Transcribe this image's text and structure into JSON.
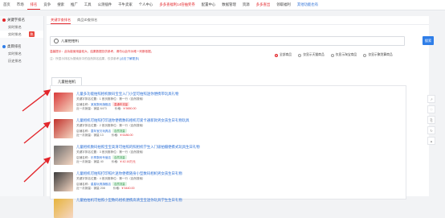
{
  "topnav": {
    "items": [
      {
        "label": "首页",
        "style": "normal"
      },
      {
        "label": "市场",
        "style": "normal"
      },
      {
        "label": "排名",
        "style": "active"
      },
      {
        "label": "竞争",
        "style": "normal"
      },
      {
        "label": "搜索",
        "style": "normal"
      },
      {
        "label": "推广",
        "style": "normal"
      },
      {
        "label": "工具",
        "style": "normal"
      },
      {
        "label": "公测插件",
        "style": "normal"
      },
      {
        "label": "千牛卖家",
        "style": "normal"
      },
      {
        "label": "个人中心",
        "style": "normal"
      },
      {
        "label": "多多查福利14倍抽奖券",
        "style": "red"
      },
      {
        "label": "配置中心",
        "style": "normal"
      },
      {
        "label": "数据管理",
        "style": "normal"
      },
      {
        "label": "资源",
        "style": "normal"
      },
      {
        "label": "多多查出",
        "style": "red"
      },
      {
        "label": "领取福利",
        "style": "normal"
      },
      {
        "label": "其他功能也有",
        "style": "blue"
      }
    ]
  },
  "sidebar": {
    "groups": [
      {
        "label": "关键字排名",
        "color": "#e3262b",
        "items": [
          {
            "label": "实时排名",
            "badge": ""
          },
          {
            "label": "实时排名",
            "badge": "热",
            "active": true
          }
        ]
      },
      {
        "label": "类目排名",
        "color": "#2f7ee8",
        "items": [
          {
            "label": "实时排名",
            "badge": ""
          },
          {
            "label": "历史排名",
            "badge": ""
          }
        ]
      }
    ]
  },
  "main": {
    "tabs": [
      {
        "label": "关键字查排名"
      },
      {
        "label": "商品ID查排名"
      }
    ],
    "search": {
      "value": "儿童拍拍机",
      "button": "搜索"
    },
    "hint": "温馨提示：此功能使用量较大，结果数据仅供参考，请勿以此作为唯一判断依据。",
    "hint2": "注：所显示排名为搜索页中的自然排名结果，仅供参考",
    "hint2_link": "[点击了解更多]",
    "radios": [
      {
        "label": "全部商品",
        "on": true
      },
      {
        "label": "仅显示天猫商品",
        "on": false
      },
      {
        "label": "仅显示淘宝商品",
        "on": false
      },
      {
        "label": "仅显示聚划算商品",
        "on": false
      }
    ],
    "result_tab": "儿童拍拍机"
  },
  "results": [
    {
      "title": "儿童多功能拍照相机数码宝宝入门小型可拍照迷你便携带玩具礼物",
      "row1": "关键字排名位置：1  首页推荐位：第一行（自然搜索）",
      "row2": "店铺名称：",
      "shop": "某某数码旗舰店",
      "tag": "直通车流量",
      "tag_type": "red",
      "row3": "近一月销量：",
      "sales": "销量 6473",
      "price_label": "价格：",
      "price": "¥ 5650.00",
      "thumb_color": "#d83a3a"
    },
    {
      "title": "儿童相机可拍照打印迷你便携数码相机可爱卡通新款男女孩生日礼物玩具",
      "row1": "关键字排名位置：2  首页推荐位：第一行（自然搜索）",
      "row2": "店铺名称：",
      "shop": "童年宝贝玩具店",
      "tag": "自然流量",
      "tag_type": "green",
      "row3": "近一月销量：",
      "sales": "销量 13",
      "price_label": "价格：",
      "price": "¥ 6186.00",
      "thumb_color": "#c0322c"
    },
    {
      "title": "儿童相机数码拍照宝宝高清可拍照的照相机学生入门级拍摄便携式玩具生日礼物",
      "row1": "关键字排名位置：3  首页推荐位：第一行（自然搜索）",
      "row2": "店铺名称：",
      "shop": "乐享数码专营店",
      "tag": "自然流量",
      "tag_type": "green",
      "row3": "近一月销量：",
      "sales": "销量 40",
      "price_label": "价格：",
      "price": "¥ 42.16万元",
      "thumb_color": "#6b6b6b"
    },
    {
      "title": "儿童相机可拍照打印照片迷你便携随身小型数码相机男女孩生日礼物",
      "row1": "关键字排名位置：4  首页推荐位：第一行（自然搜索）",
      "row2": "店铺名称：",
      "shop": "星星玩具旗舰店",
      "tag": "自然流量",
      "tag_type": "green",
      "row3": "近一月销量：",
      "sales": "销量 208",
      "price_label": "价格：",
      "price": "¥ 5440.00",
      "thumb_color": "#3c3c3c"
    },
    {
      "title": "儿童拍拍机可拍照小型数码相机便携高清宝宝迷你玩具学生生日礼物",
      "row1": "",
      "row2": "",
      "shop": "",
      "tag": "",
      "tag_type": "gray",
      "row3": "",
      "sales": "",
      "price_label": "",
      "price": "",
      "thumb_color": "#e6b33c"
    }
  ],
  "rightbar": {
    "icons": [
      "share-icon",
      "heart-icon",
      "copy-icon",
      "refresh-icon",
      "top-icon"
    ]
  },
  "colors": {
    "accent": "#e3262b",
    "primary": "#2f7ee8",
    "link": "#2b6fd6"
  }
}
